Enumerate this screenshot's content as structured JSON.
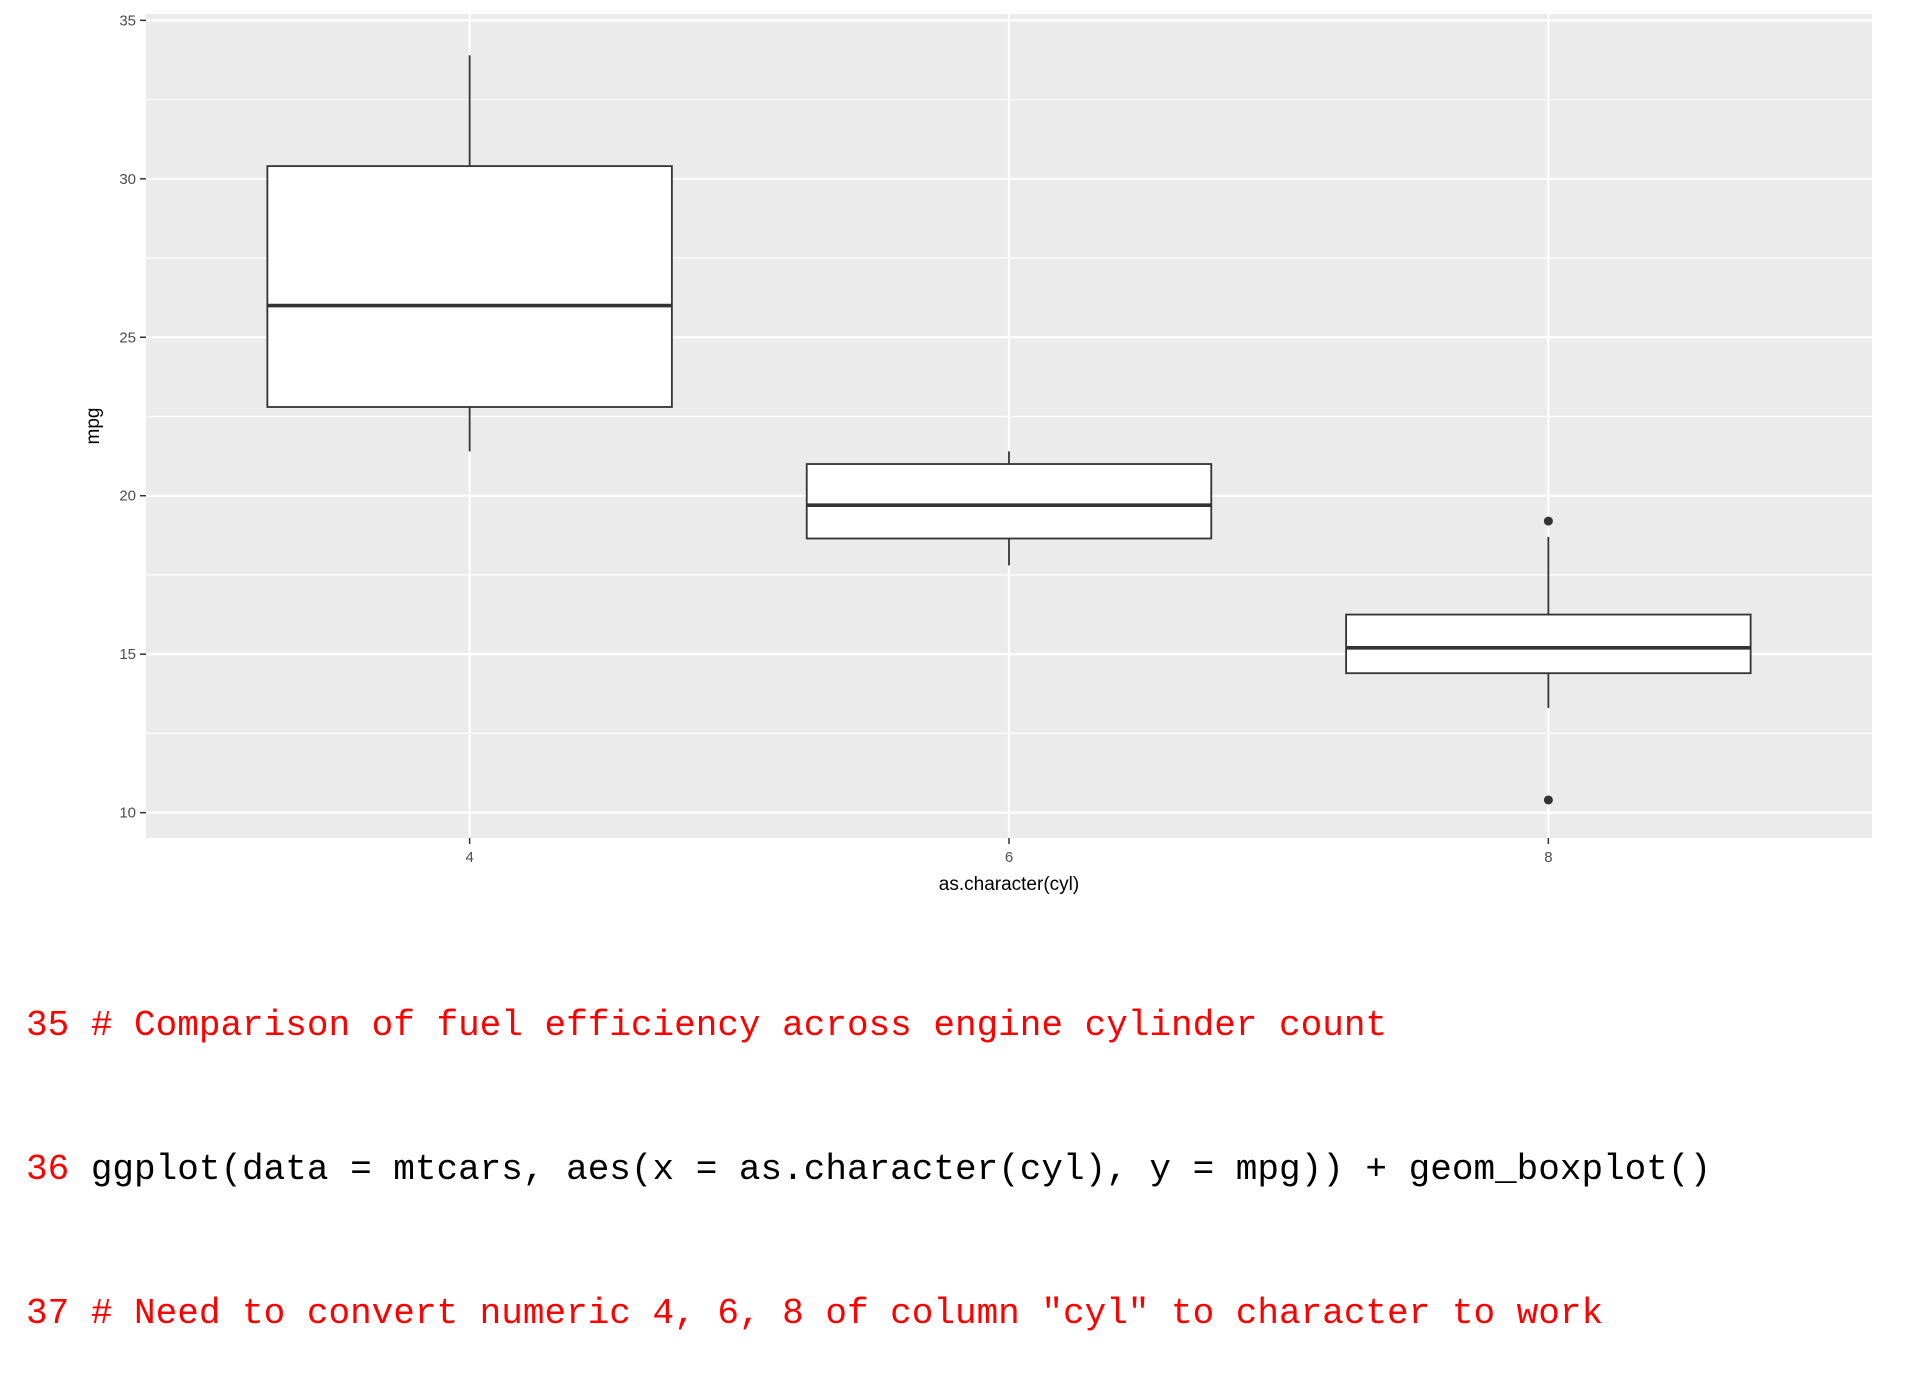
{
  "chart_data": {
    "type": "boxplot",
    "xlabel": "as.character(cyl)",
    "ylabel": "mpg",
    "ylim": [
      9.2,
      35.2
    ],
    "yticks": [
      10,
      15,
      20,
      25,
      30,
      35
    ],
    "grid": true,
    "categories": [
      "4",
      "6",
      "8"
    ],
    "boxes": [
      {
        "category": "4",
        "min": 21.4,
        "q1": 22.8,
        "median": 26.0,
        "q3": 30.4,
        "max": 33.9,
        "outliers": []
      },
      {
        "category": "6",
        "min": 17.8,
        "q1": 18.65,
        "median": 19.7,
        "q3": 21.0,
        "max": 21.4,
        "outliers": []
      },
      {
        "category": "8",
        "min": 13.3,
        "q1": 14.4,
        "median": 15.2,
        "q3": 16.25,
        "max": 18.7,
        "outliers": [
          19.2,
          10.4
        ]
      }
    ],
    "colors": {
      "panel": "#ebebeb",
      "grid": "#ffffff",
      "box_fill": "#ffffff",
      "box_stroke": "#333333"
    }
  },
  "code": {
    "lines": [
      {
        "number": "35",
        "text": " # Comparison of fuel efficiency across engine cylinder count",
        "kind": "comment"
      },
      {
        "number": "36",
        "text": " ggplot(data = mtcars, aes(x = as.character(cyl), y = mpg)) + geom_boxplot()",
        "kind": "code"
      },
      {
        "number": "37",
        "text": " # Need to convert numeric 4, 6, 8 of column \"cyl\" to character to work",
        "kind": "comment"
      }
    ]
  }
}
